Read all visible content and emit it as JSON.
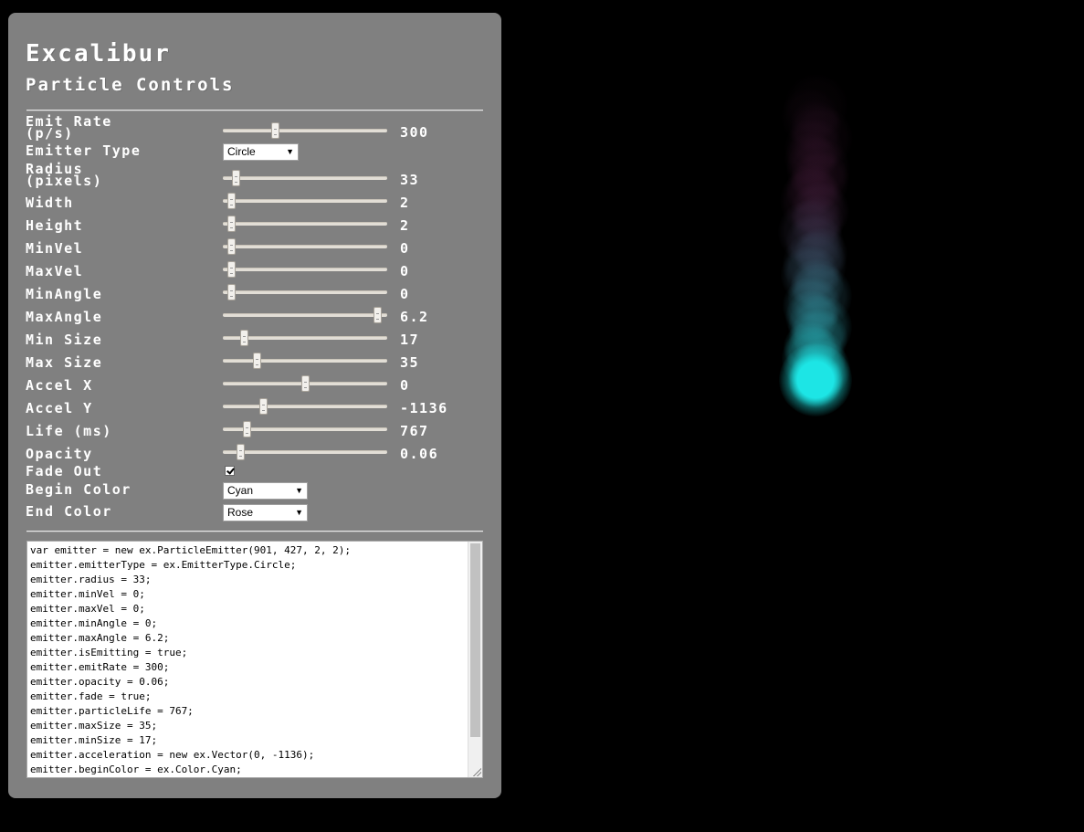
{
  "title": "Excalibur",
  "subtitle": "Particle Controls",
  "controls": {
    "emit_rate": {
      "label": "Emit Rate\n(p/s)",
      "value": "300",
      "fraction": 0.31
    },
    "emitter_type": {
      "label": "Emitter Type",
      "selected": "Circle"
    },
    "radius": {
      "label": "Radius\n(pixels)",
      "value": "33",
      "fraction": 0.06
    },
    "width": {
      "label": "Width",
      "value": "2",
      "fraction": 0.03
    },
    "height": {
      "label": "Height",
      "value": "2",
      "fraction": 0.03
    },
    "min_vel": {
      "label": "MinVel",
      "value": "0",
      "fraction": 0.03
    },
    "max_vel": {
      "label": "MaxVel",
      "value": "0",
      "fraction": 0.03
    },
    "min_angle": {
      "label": "MinAngle",
      "value": "0",
      "fraction": 0.03
    },
    "max_angle": {
      "label": "MaxAngle",
      "value": "6.2",
      "fraction": 0.96
    },
    "min_size": {
      "label": "Min Size",
      "value": "17",
      "fraction": 0.11
    },
    "max_size": {
      "label": "Max Size",
      "value": "35",
      "fraction": 0.19
    },
    "accel_x": {
      "label": "Accel X",
      "value": "0",
      "fraction": 0.5
    },
    "accel_y": {
      "label": "Accel Y",
      "value": "-1136",
      "fraction": 0.23
    },
    "life": {
      "label": "Life (ms)",
      "value": "767",
      "fraction": 0.13
    },
    "opacity": {
      "label": "Opacity",
      "value": "0.06",
      "fraction": 0.09
    },
    "fade_out": {
      "label": "Fade Out",
      "checked": true
    },
    "begin_color": {
      "label": "Begin Color",
      "selected": "Cyan"
    },
    "end_color": {
      "label": "End Color",
      "selected": "Rose"
    }
  },
  "code": "var emitter = new ex.ParticleEmitter(901, 427, 2, 2);\nemitter.emitterType = ex.EmitterType.Circle;\nemitter.radius = 33;\nemitter.minVel = 0;\nemitter.maxVel = 0;\nemitter.minAngle = 0;\nemitter.maxAngle = 6.2;\nemitter.isEmitting = true;\nemitter.emitRate = 300;\nemitter.opacity = 0.06;\nemitter.fade = true;\nemitter.particleLife = 767;\nemitter.maxSize = 35;\nemitter.minSize = 17;\nemitter.acceleration = new ex.Vector(0, -1136);\nemitter.beginColor = ex.Color.Cyan;",
  "colors": {
    "begin": "#1de5e5",
    "end": "#6b2a5a"
  },
  "icons": {
    "dropdown": "triangle-down-icon",
    "checkbox": "checkmark-icon"
  }
}
